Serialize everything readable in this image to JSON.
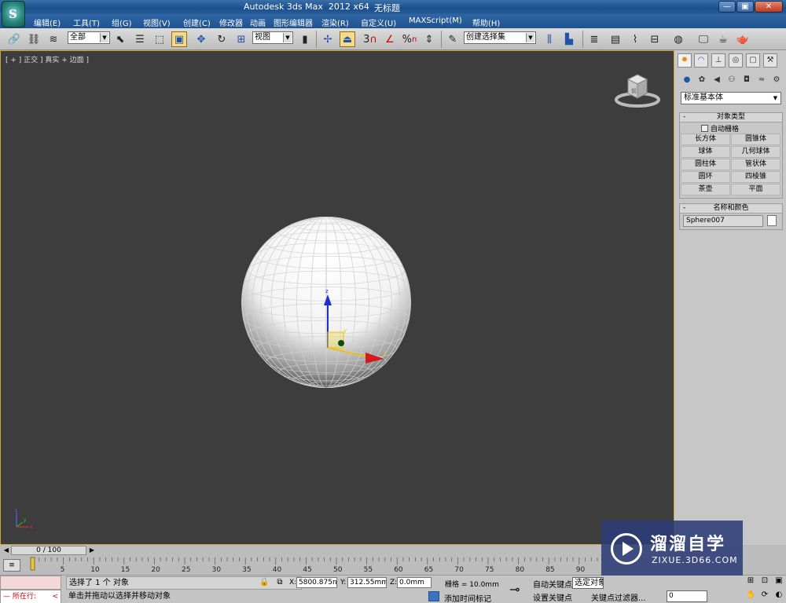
{
  "titlebar": {
    "title": "Autodesk 3ds Max  2012 x64",
    "document": "无标题",
    "app_icon": "3dsmax-logo-icon",
    "buttons": [
      "minimize-icon",
      "maximize-icon",
      "close-icon"
    ]
  },
  "menu": {
    "items": [
      "编辑(E)",
      "工具(T)",
      "组(G)",
      "视图(V)",
      "创建(C)",
      "修改器",
      "动画",
      "图形编辑器",
      "渲染(R)",
      "自定义(U)",
      "MAXScript(M)",
      "帮助(H)"
    ]
  },
  "toolbar": {
    "selection_filter": "全部",
    "ref_coord": "视图",
    "named_selection": "创建选择集",
    "snap_label": "3",
    "pct_label": "%"
  },
  "viewport": {
    "label": "[ + ] 正交 ] 真实 + 边面 ]",
    "viewcube_face": "前",
    "object": "sphere",
    "gizmo_axes": [
      "x",
      "y",
      "z"
    ],
    "axis_tripod": [
      "x",
      "y",
      "z"
    ]
  },
  "command_panel": {
    "tabs": [
      "create-tab-icon",
      "modify-tab-icon",
      "hierarchy-tab-icon",
      "motion-tab-icon",
      "display-tab-icon",
      "utilities-tab-icon"
    ],
    "subtabs": [
      "geometry-icon",
      "shapes-icon",
      "lights-icon",
      "cameras-icon",
      "helpers-icon",
      "spacewarps-icon",
      "systems-icon"
    ],
    "primitive_type": "标准基本体",
    "object_type": {
      "title": "对象类型",
      "autogrid": "自动栅格",
      "buttons": [
        "长方体",
        "圆锥体",
        "球体",
        "几何球体",
        "圆柱体",
        "管状体",
        "圆环",
        "四棱锥",
        "茶壶",
        "平面"
      ]
    },
    "name_color": {
      "title": "名称和颜色",
      "name": "Sphere007",
      "color": "#ffffff"
    }
  },
  "timeline": {
    "frame_display": "0 / 100",
    "ticks": [
      "5",
      "10",
      "15",
      "20",
      "25",
      "30",
      "35",
      "40",
      "45",
      "50",
      "55",
      "60",
      "65",
      "70",
      "75",
      "80",
      "85",
      "90"
    ]
  },
  "status": {
    "running_label": "所在行:",
    "selection": "选择了 1 个 对象",
    "prompt": "单击并拖动以选择并移动对象",
    "x_label": "X:",
    "x_value": "5800.875n",
    "y_label": "Y:",
    "y_value": "312.55mm",
    "z_label": "Z:",
    "z_value": "0.0mm",
    "grid": "栅格 = 10.0mm",
    "add_time_tag": "添加时间标记",
    "auto_key": "自动关键点",
    "set_key": "设置关键点",
    "selected_dd": "选定对象",
    "key_filters": "关键点过滤器...",
    "frame": "0"
  },
  "watermark": {
    "title": "溜溜自学",
    "url": "ZIXUE.3D66.COM"
  }
}
